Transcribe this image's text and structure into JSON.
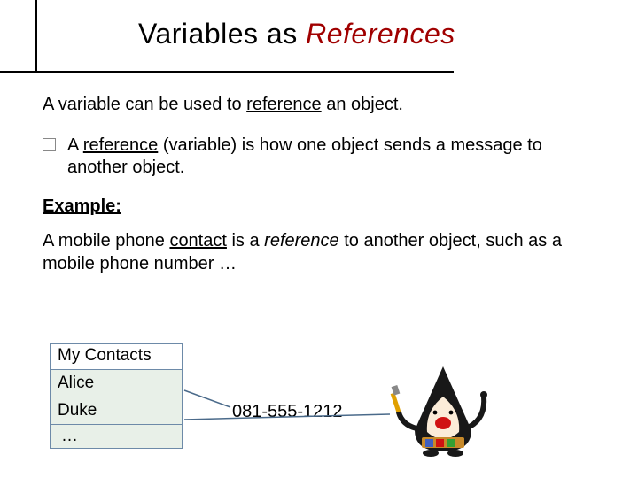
{
  "title": {
    "plain": "Variables as ",
    "emph": "References"
  },
  "paragraphs": {
    "intro_a": "A variable can be used to ",
    "intro_u": "reference",
    "intro_b": " an object.",
    "bullet_a": "A ",
    "bullet_u": "reference",
    "bullet_b": " (variable) is how one object sends a message to another object.",
    "example_label": "Example:",
    "example_a": "A mobile phone ",
    "example_u1": "contact",
    "example_b": " is a ",
    "example_u2": "reference",
    "example_c": " to another object, such as a mobile phone number …"
  },
  "contacts": {
    "header": "My Contacts",
    "rows": [
      "Alice",
      "Duke",
      " …"
    ]
  },
  "phone_number": "081-555-1212"
}
